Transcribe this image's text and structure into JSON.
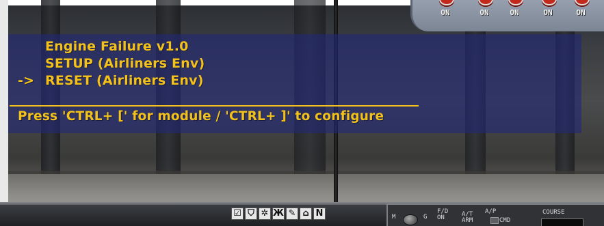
{
  "menu": {
    "title": "Engine Failure v1.0",
    "items": [
      {
        "label": "SETUP (Airliners Env)",
        "selected": false
      },
      {
        "label": "RESET (Airliners Env)",
        "selected": true
      }
    ],
    "selection_marker": "->",
    "hint": "Press 'CTRL+ [' for module / 'CTRL+ ]' to configure",
    "text_color": "#f2c21b",
    "overlay_color": "#222876"
  },
  "overhead_panel": {
    "switches": [
      {
        "label": "ON"
      },
      {
        "label": "ON"
      },
      {
        "label": "ON"
      },
      {
        "label": "ON"
      },
      {
        "label": "ON"
      }
    ],
    "knob_color": "#c2281c"
  },
  "toolbar": {
    "icons": [
      {
        "name": "checkbox-icon",
        "glyph": "☑"
      },
      {
        "name": "shield-check-icon",
        "glyph": "⛉"
      },
      {
        "name": "gear-icon",
        "glyph": "✲"
      },
      {
        "name": "antenna-icon",
        "glyph": "Ж"
      },
      {
        "name": "edit-icon",
        "glyph": "✎"
      },
      {
        "name": "map-icon",
        "glyph": "⌂"
      },
      {
        "name": "nav-icon",
        "glyph": "N"
      }
    ]
  },
  "mcp": {
    "labels": {
      "m": "M",
      "g": "G",
      "fd": "F/D\nON",
      "at": "A/T\nARM",
      "ap": "A/P",
      "cmd": "CMD",
      "course": "COURSE"
    }
  }
}
